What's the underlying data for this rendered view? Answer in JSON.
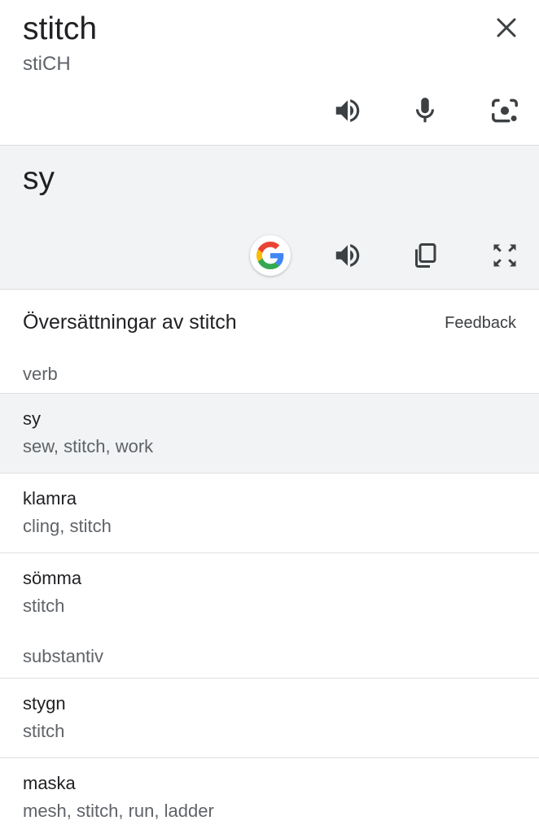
{
  "source": {
    "word": "stitch",
    "phonetic": "stiCH",
    "close_icon": "close-icon",
    "icons": [
      "speaker-icon",
      "microphone-icon",
      "camera-lens-icon"
    ]
  },
  "target": {
    "word": "sy",
    "icons": [
      "google-logo-icon",
      "speaker-icon",
      "copy-icon",
      "fullscreen-icon"
    ]
  },
  "translations": {
    "header": "Översättningar av stitch",
    "feedback": "Feedback",
    "groups": [
      {
        "pos": "verb",
        "entries": [
          {
            "word": "sy",
            "meanings": "sew, stitch, work",
            "selected": true
          },
          {
            "word": "klamra",
            "meanings": "cling, stitch"
          },
          {
            "word": "sömma",
            "meanings": "stitch"
          }
        ]
      },
      {
        "pos": "substantiv",
        "entries": [
          {
            "word": "stygn",
            "meanings": "stitch"
          },
          {
            "word": "maska",
            "meanings": "mesh, stitch, run, ladder"
          }
        ]
      }
    ]
  },
  "colors": {
    "text": "#202124",
    "secondary": "#5f6368",
    "panel": "#f1f3f4",
    "divider": "#dadce0"
  }
}
